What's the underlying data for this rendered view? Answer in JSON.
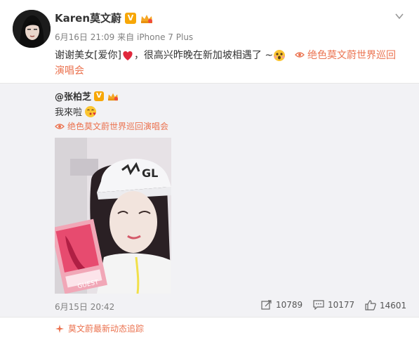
{
  "post": {
    "author": "Karen莫文蔚",
    "verified_badge": "V",
    "meta_time": "6月16日 21:09",
    "meta_from": "来自",
    "meta_device": "iPhone 7 Plus",
    "text": "谢谢美女[爱你]",
    "text_after_heart": "，很高兴昨晚在新加坡相遇了 ~",
    "topic_link": "绝色莫文蔚世界巡回演唱会",
    "icons": [
      "avatar",
      "verified-icon",
      "crown-icon",
      "chevron-down-icon",
      "heart-emoji",
      "surprised-emoji",
      "topic-icon"
    ]
  },
  "repost": {
    "author": "@张柏芝",
    "text": "我來啦",
    "topic_link": "绝色莫文蔚世界巡回演唱会",
    "time": "6月15日 20:42",
    "stats": {
      "reposts": "10789",
      "comments": "10177",
      "likes": "14601"
    },
    "icons": [
      "repost-icon",
      "comment-icon",
      "like-icon",
      "photo"
    ]
  },
  "footer": {
    "label": "莫文蔚最新动态追踪"
  },
  "colors": {
    "link": "#eb7350",
    "repost_bg": "#f2f2f5",
    "badge": "#f7a707",
    "muted": "#808080"
  }
}
